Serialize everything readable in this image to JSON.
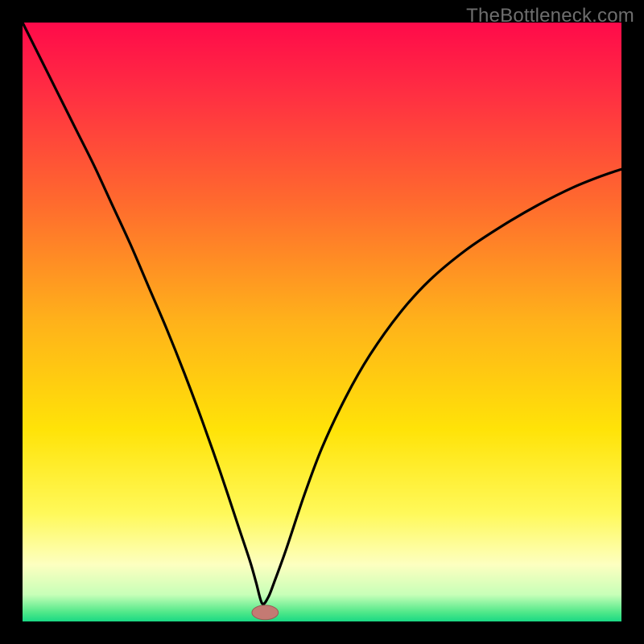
{
  "watermark": "TheBottleneck.com",
  "colors": {
    "frame": "#000000",
    "curve": "#000000",
    "marker_fill": "#c47a73",
    "marker_stroke": "#9a5a55",
    "gradient_stops": [
      {
        "offset": 0.0,
        "color": "#ff0a4a"
      },
      {
        "offset": 0.12,
        "color": "#ff2f42"
      },
      {
        "offset": 0.3,
        "color": "#ff6a2e"
      },
      {
        "offset": 0.5,
        "color": "#ffb21a"
      },
      {
        "offset": 0.68,
        "color": "#ffe308"
      },
      {
        "offset": 0.82,
        "color": "#fff95a"
      },
      {
        "offset": 0.905,
        "color": "#fdffc0"
      },
      {
        "offset": 0.955,
        "color": "#c8ffb8"
      },
      {
        "offset": 0.985,
        "color": "#4fe889"
      },
      {
        "offset": 1.0,
        "color": "#1ad884"
      }
    ]
  },
  "chart_data": {
    "type": "line",
    "title": "",
    "xlabel": "",
    "ylabel": "",
    "xlim": [
      0,
      100
    ],
    "ylim": [
      0,
      100
    ],
    "minimum_x": 40,
    "marker": {
      "x": 40.5,
      "y": 1.5,
      "rx": 2.2,
      "ry": 1.2
    },
    "series": [
      {
        "name": "curve",
        "x": [
          0,
          3,
          6,
          9,
          12,
          15,
          18,
          21,
          24,
          27,
          30,
          33,
          36,
          38,
          39,
          40,
          41,
          42,
          44,
          47,
          50,
          54,
          58,
          63,
          68,
          74,
          80,
          86,
          92,
          97,
          100
        ],
        "values": [
          100,
          94,
          88,
          82,
          76,
          69.5,
          63,
          56,
          49,
          41.5,
          33.5,
          25,
          16,
          10,
          6.5,
          3,
          4,
          6.5,
          12,
          21,
          29,
          37.5,
          44.5,
          51.5,
          57,
          62,
          66,
          69.5,
          72.5,
          74.5,
          75.5
        ]
      }
    ]
  }
}
